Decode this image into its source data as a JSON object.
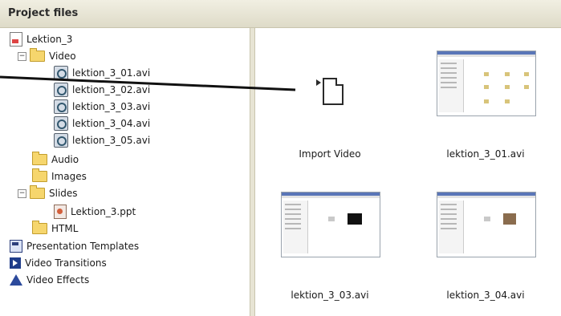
{
  "panel": {
    "title": "Project files"
  },
  "tree": {
    "root": {
      "label": "Lektion_3",
      "icon": "project-icon"
    },
    "video_folder": {
      "label": "Video",
      "expander": "−"
    },
    "videos": [
      "lektion_3_01.avi",
      "lektion_3_02.avi",
      "lektion_3_03.avi",
      "lektion_3_04.avi",
      "lektion_3_05.avi"
    ],
    "audio": {
      "label": "Audio"
    },
    "images": {
      "label": "Images"
    },
    "slides_folder": {
      "label": "Slides",
      "expander": "−"
    },
    "slides_file": {
      "label": "Lektion_3.ppt"
    },
    "html": {
      "label": "HTML"
    },
    "presentation_templates": {
      "label": "Presentation Templates"
    },
    "video_transitions": {
      "label": "Video Transitions"
    },
    "video_effects": {
      "label": "Video Effects"
    }
  },
  "content": {
    "items": [
      {
        "label": "Import Video",
        "kind": "import"
      },
      {
        "label": "lektion_3_01.avi",
        "kind": "thumbnail"
      },
      {
        "label": "lektion_3_03.avi",
        "kind": "thumbnail"
      },
      {
        "label": "lektion_3_04.avi",
        "kind": "thumbnail"
      }
    ]
  },
  "colors": {
    "titlebar": "#dedbc8",
    "folder": "#f6d66d",
    "accent": "#1f3d8a"
  }
}
